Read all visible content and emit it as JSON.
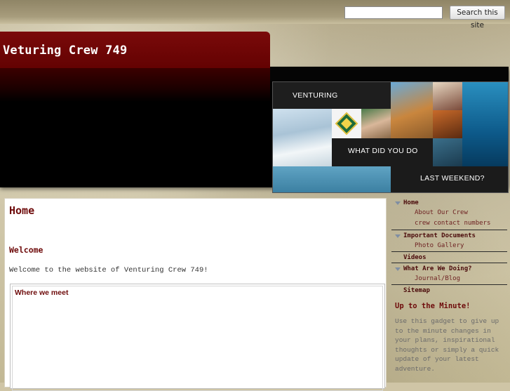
{
  "search": {
    "placeholder": "",
    "button_label": "Search this site"
  },
  "site": {
    "title": "Veturing Crew 749"
  },
  "banner": {
    "labels": [
      "VENTURING",
      "WHAT DID YOU DO",
      "LAST WEEKEND?"
    ]
  },
  "page": {
    "title": "Home",
    "heading": "Welcome",
    "welcome_text": "Welcome to the website of Venturing Crew 749!",
    "gadget_title": "Where we meet"
  },
  "sidebar": {
    "nav": [
      {
        "label": "Home",
        "children": [
          "About Our Crew",
          "crew contact numbers"
        ]
      },
      {
        "label": "Important Documents",
        "children": [
          "Photo Gallery"
        ]
      },
      {
        "label": "Videos",
        "children": []
      },
      {
        "label": "What Are We Doing?",
        "children": [
          "Journal/Blog"
        ]
      },
      {
        "label": "Sitemap",
        "children": []
      }
    ],
    "gadget": {
      "title": "Up to the Minute!",
      "text": "Use this gadget to give up to the minute changes in your plans, inspirational thoughts or simply a quick update of your latest adventure."
    }
  },
  "colors": {
    "title_bar": "#6e0707",
    "accent_text": "#6e0b0b",
    "header_black": "#000000"
  }
}
